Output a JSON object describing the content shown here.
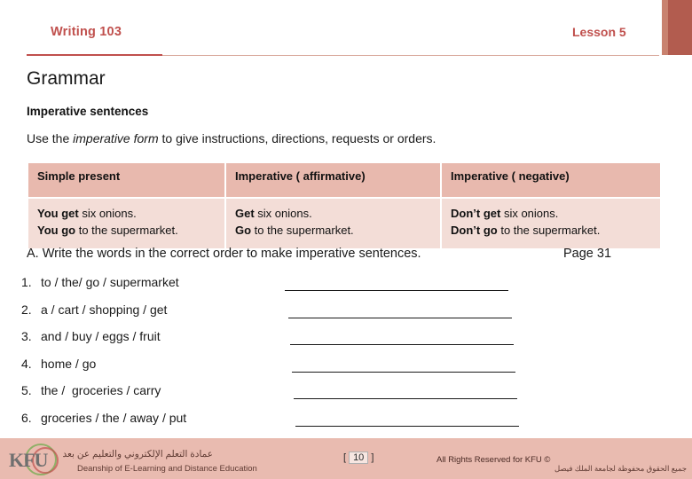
{
  "header": {
    "course": "Writing 103",
    "lesson": "Lesson 5"
  },
  "body": {
    "title": "Grammar",
    "subtitle": "Imperative sentences",
    "lead_prefix": "Use the ",
    "lead_em": "imperative form",
    "lead_suffix": " to give instructions, directions, requests or orders."
  },
  "table": {
    "headers": [
      "Simple present",
      "Imperative ( affirmative)",
      "Imperative ( negative)"
    ],
    "rows": [
      {
        "col1_line1_bold": "You get",
        "col1_line1_rest": " six onions.",
        "col1_line2_bold": "You go",
        "col1_line2_rest": " to the supermarket.",
        "col2_line1_bold": "Get",
        "col2_line1_rest": " six onions.",
        "col2_line2_bold": "Go",
        "col2_line2_rest": " to the supermarket.",
        "col3_line1_bold": "Don’t get",
        "col3_line1_rest": " six onions.",
        "col3_line2_bold": "Don’t go",
        "col3_line2_rest": " to the supermarket."
      }
    ]
  },
  "exercise": {
    "instruction": "A. Write the words in the correct order to make imperative sentences.",
    "page_ref": "Page 31",
    "items": [
      {
        "num": "1.",
        "text": "to / the/ go / supermarket"
      },
      {
        "num": "2.",
        "text": "a / cart / shopping / get"
      },
      {
        "num": "3.",
        "text": "and / buy / eggs / fruit"
      },
      {
        "num": "4.",
        "text": "home / go"
      },
      {
        "num": "5.",
        "text": "the /  groceries / carry"
      },
      {
        "num": "6.",
        "text": "groceries / the / away / put"
      }
    ]
  },
  "footer": {
    "arabic_title": "عمادة التعلم الإلكتروني والتعليم عن بعد",
    "english_title": "Deanship of E-Learning and Distance Education",
    "rights": "All Rights Reserved for KFU ©",
    "arabic_rights": "جميع الحقوق محفوظة لجامعة الملك فيصل",
    "page_number": "10",
    "bracket_left": "[",
    "bracket_right": "]",
    "logo_text": "KFU"
  }
}
